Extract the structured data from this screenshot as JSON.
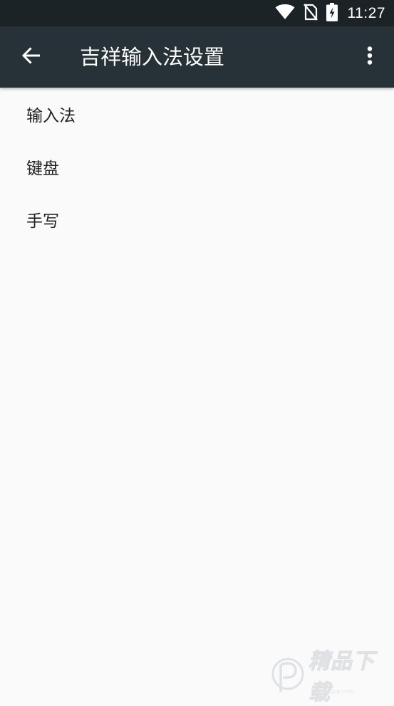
{
  "status_bar": {
    "time": "11:27",
    "icons": [
      "wifi-icon",
      "no-sim-icon",
      "battery-charging-icon"
    ]
  },
  "app_bar": {
    "title": "吉祥输入法设置",
    "back_icon": "arrow-back-icon",
    "overflow_icon": "more-vert-icon"
  },
  "preferences": {
    "items": [
      {
        "label": "输入法"
      },
      {
        "label": "键盘"
      },
      {
        "label": "手写"
      }
    ]
  },
  "watermark": {
    "text": "精品下载",
    "url": "www.jsjpg.com"
  },
  "colors": {
    "status_bar": "#1c2326",
    "app_bar": "#263238",
    "background": "#fafafa",
    "text_primary": "#212121"
  }
}
